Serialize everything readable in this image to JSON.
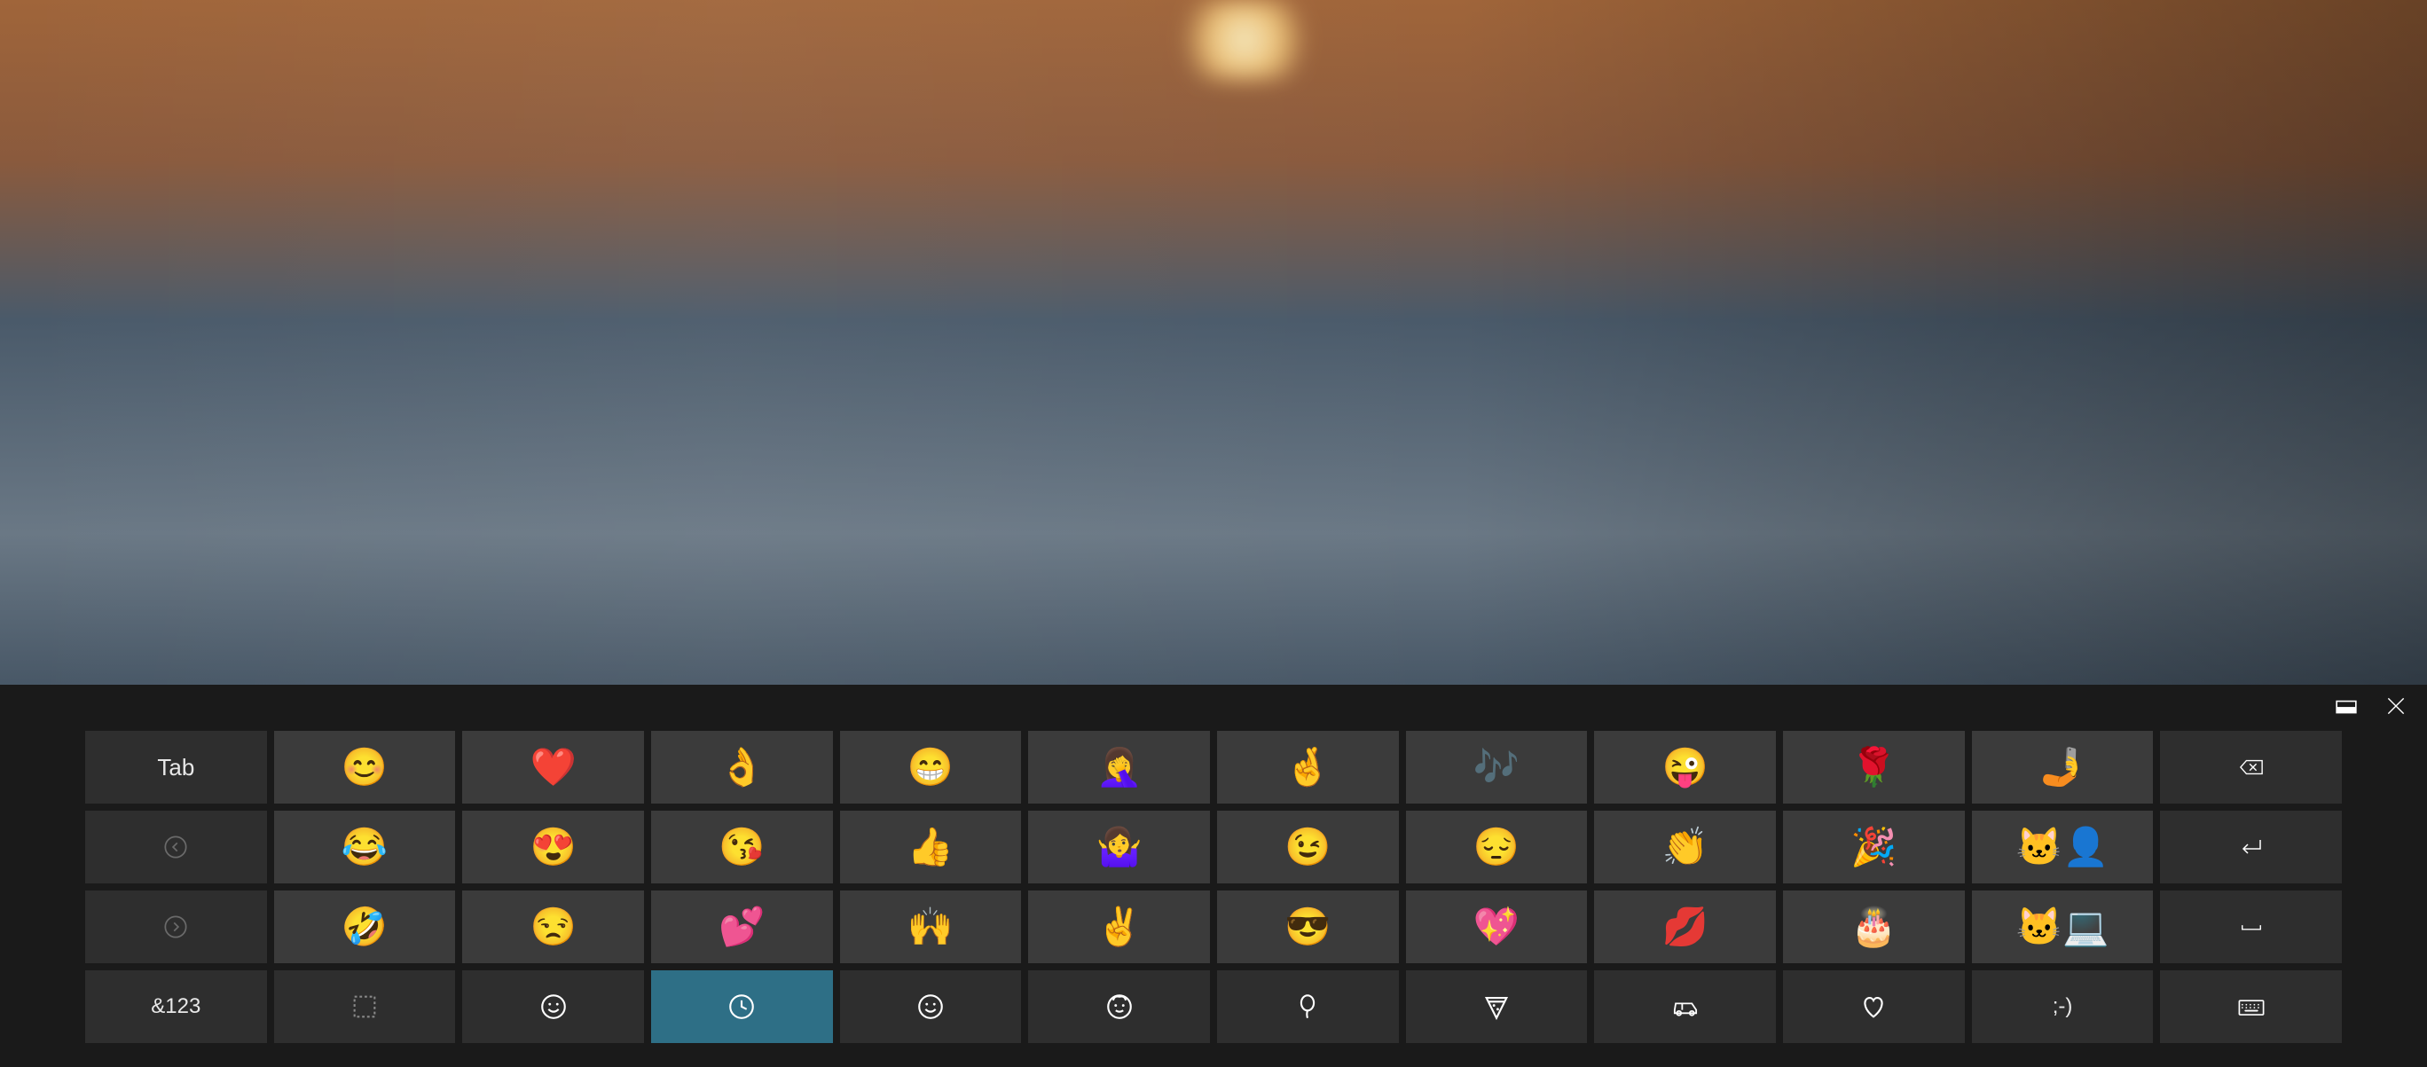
{
  "topbar": {
    "layout_icon": "keyboard-layout-icon",
    "close_icon": "close-icon"
  },
  "rows": {
    "r1": {
      "tab_label": "Tab",
      "emojis": [
        "😊",
        "❤️",
        "👌",
        "😁",
        "🤦‍♀️",
        "🤞",
        "🎶",
        "😜",
        "🌹",
        "🤳"
      ],
      "backspace_icon": "backspace-icon"
    },
    "r2": {
      "prev_icon": "chevron-left-icon",
      "emojis": [
        "😂",
        "😍",
        "😘",
        "👍",
        "🤷‍♀️",
        "😉",
        "😔",
        "👏",
        "🎉",
        "🐱‍👤"
      ],
      "enter_icon": "enter-icon"
    },
    "r3": {
      "next_icon": "chevron-right-icon",
      "emojis": [
        "🤣",
        "😒",
        "💕",
        "🙌",
        "✌️",
        "😎",
        "💖",
        "💋",
        "🎂",
        "🐱‍💻"
      ],
      "space_icon": "space-icon"
    },
    "r4": {
      "numsym_label": "&123",
      "categories": [
        {
          "id": "select",
          "name": "select-icon"
        },
        {
          "id": "faces",
          "name": "smiley-outline-icon"
        },
        {
          "id": "recent",
          "name": "clock-icon",
          "selected": true
        },
        {
          "id": "smileys",
          "name": "smiley-outline-icon"
        },
        {
          "id": "people",
          "name": "people-icon"
        },
        {
          "id": "celebrate",
          "name": "balloon-icon"
        },
        {
          "id": "food",
          "name": "pizza-icon"
        },
        {
          "id": "transport",
          "name": "car-icon"
        },
        {
          "id": "symbols",
          "name": "heart-outline-icon"
        },
        {
          "id": "ascii",
          "name": "ascii-face"
        }
      ],
      "ascii_label": ";-)",
      "keyboard_icon": "keyboard-icon"
    }
  }
}
